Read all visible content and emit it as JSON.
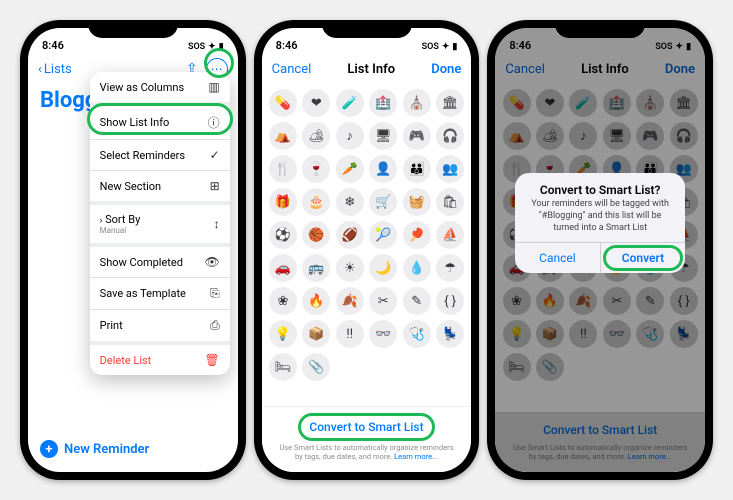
{
  "status": {
    "time": "8:46",
    "carrier": "SOS",
    "signal": "▪▪▪",
    "wifi": "✦",
    "battery": "▮"
  },
  "phone1": {
    "back_label": "Lists",
    "title": "Bloggi",
    "menu": [
      {
        "label": "View as Columns",
        "icon": "▥",
        "sep": true
      },
      {
        "label": "Show List Info",
        "icon": "ⓘ",
        "highlight": true
      },
      {
        "label": "Select Reminders",
        "icon": "✓"
      },
      {
        "label": "New Section",
        "icon": "⊞",
        "sep": true
      },
      {
        "label": "Sort By",
        "sub": "Manual",
        "icon": "↕",
        "chevron": true,
        "sep": true
      },
      {
        "label": "Show Completed",
        "icon": "👁"
      },
      {
        "label": "Save as Template",
        "icon": "⎘"
      },
      {
        "label": "Print",
        "icon": "⎙",
        "sep": true
      },
      {
        "label": "Delete List",
        "icon": "🗑",
        "destructive": true
      }
    ],
    "new_reminder": "New Reminder"
  },
  "listinfo": {
    "cancel": "Cancel",
    "title": "List Info",
    "done": "Done",
    "icons": [
      "💊",
      "❤",
      "🧪",
      "🏥",
      "⛪",
      "🏛",
      "⛺",
      "🏕",
      "♪",
      "🖥",
      "🎮",
      "🎧",
      "🍴",
      "🍷",
      "🥕",
      "👤",
      "👪",
      "👥",
      "🎁",
      "🎂",
      "❄",
      "🛒",
      "🧺",
      "🛍",
      "⚽",
      "🏀",
      "🏈",
      "🎾",
      "🏓",
      "⛵",
      "🚗",
      "🚌",
      "☀",
      "🌙",
      "💧",
      "☂",
      "❀",
      "🔥",
      "🍂",
      "✂",
      "✎",
      "{ }",
      "💡",
      "📦",
      "‼",
      "👓",
      "🩺",
      "💺",
      "🛏",
      "📎"
    ],
    "cta": "Convert to Smart List",
    "note_a": "Use Smart Lists to automatically organize reminders by tags, due dates, and more. ",
    "note_link": "Learn more..."
  },
  "alert": {
    "title": "Convert to Smart List?",
    "message": "Your reminders will be tagged with \"#Blogging\" and this list will be turned into a Smart List",
    "cancel": "Cancel",
    "convert": "Convert"
  }
}
